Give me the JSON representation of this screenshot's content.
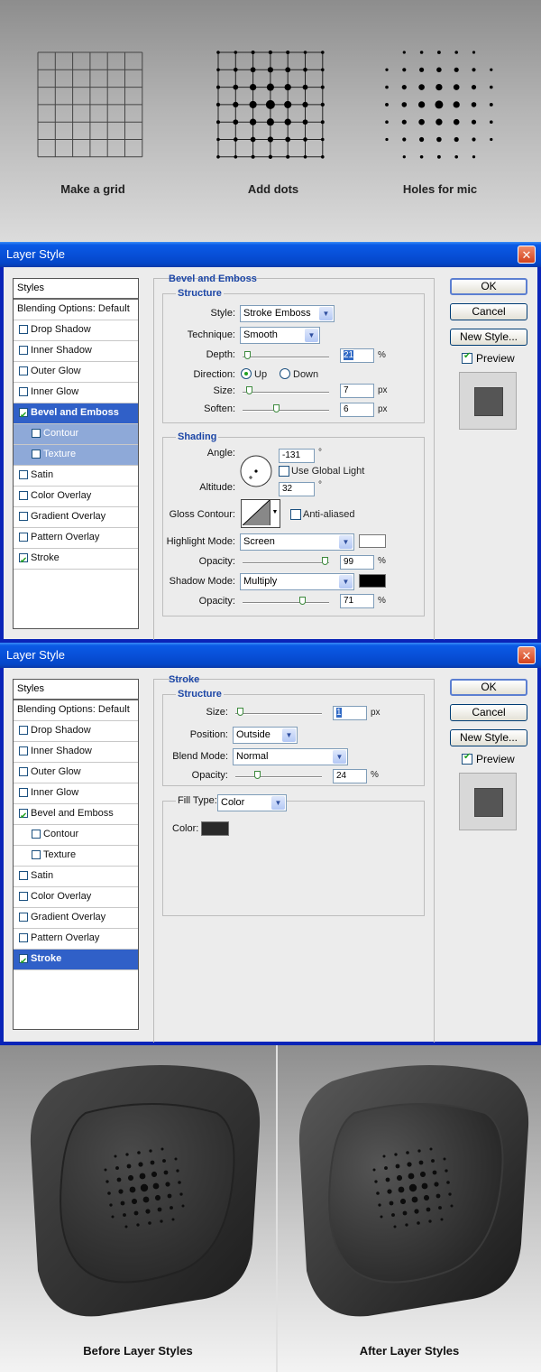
{
  "steps": {
    "captions": [
      "Make a grid",
      "Add dots",
      "Holes for mic"
    ],
    "icons": [
      "grid-icon",
      "grid-dots-icon",
      "mic-holes-icon"
    ]
  },
  "dialog1": {
    "title": "Layer Style",
    "close": "✕",
    "styles_header": "Styles",
    "blending": "Blending Options: Default",
    "items": [
      {
        "label": "Drop Shadow",
        "checked": false
      },
      {
        "label": "Inner Shadow",
        "checked": false
      },
      {
        "label": "Outer Glow",
        "checked": false
      },
      {
        "label": "Inner Glow",
        "checked": false
      },
      {
        "label": "Bevel and Emboss",
        "checked": true,
        "selected": true
      },
      {
        "label": "Contour",
        "checked": false
      },
      {
        "label": "Texture",
        "checked": false
      },
      {
        "label": "Satin",
        "checked": false
      },
      {
        "label": "Color Overlay",
        "checked": false
      },
      {
        "label": "Gradient Overlay",
        "checked": false
      },
      {
        "label": "Pattern Overlay",
        "checked": false
      },
      {
        "label": "Stroke",
        "checked": true
      }
    ],
    "section": "Bevel and Emboss",
    "structure": "Structure",
    "style_label": "Style:",
    "style_value": "Stroke Emboss",
    "technique_label": "Technique:",
    "technique_value": "Smooth",
    "depth_label": "Depth:",
    "depth_value": "21",
    "depth_unit": "%",
    "direction_label": "Direction:",
    "up": "Up",
    "down": "Down",
    "size_label": "Size:",
    "size_value": "7",
    "size_unit": "px",
    "soften_label": "Soften:",
    "soften_value": "6",
    "soften_unit": "px",
    "shading": "Shading",
    "angle_label": "Angle:",
    "angle_value": "-131",
    "degree": "°",
    "global_light": "Use Global Light",
    "altitude_label": "Altitude:",
    "altitude_value": "32",
    "gloss_label": "Gloss Contour:",
    "antialiased": "Anti-aliased",
    "highlight_label": "Highlight Mode:",
    "highlight_value": "Screen",
    "highlight_color": "#ffffff",
    "hl_opacity_label": "Opacity:",
    "hl_opacity_value": "99",
    "pct": "%",
    "shadow_label": "Shadow Mode:",
    "shadow_value": "Multiply",
    "shadow_color": "#000000",
    "sh_opacity_label": "Opacity:",
    "sh_opacity_value": "71",
    "depth_level": 0.02,
    "size_level": 0.05,
    "soften_level": 0.38,
    "hl_opacity_level": 0.99,
    "sh_opacity_level": 0.71,
    "ok": "OK",
    "cancel": "Cancel",
    "new_style": "New Style...",
    "preview": "Preview"
  },
  "dialog2": {
    "title": "Layer Style",
    "close": "✕",
    "styles_header": "Styles",
    "blending": "Blending Options: Default",
    "items": [
      {
        "label": "Drop Shadow",
        "checked": false
      },
      {
        "label": "Inner Shadow",
        "checked": false
      },
      {
        "label": "Outer Glow",
        "checked": false
      },
      {
        "label": "Inner Glow",
        "checked": false
      },
      {
        "label": "Bevel and Emboss",
        "checked": true
      },
      {
        "label": "Contour",
        "checked": false
      },
      {
        "label": "Texture",
        "checked": false
      },
      {
        "label": "Satin",
        "checked": false
      },
      {
        "label": "Color Overlay",
        "checked": false
      },
      {
        "label": "Gradient Overlay",
        "checked": false
      },
      {
        "label": "Pattern Overlay",
        "checked": false
      },
      {
        "label": "Stroke",
        "checked": true,
        "selected": true
      }
    ],
    "section": "Stroke",
    "structure": "Structure",
    "size_label": "Size:",
    "size_value": "1",
    "size_unit": "px",
    "position_label": "Position:",
    "position_value": "Outside",
    "blend_label": "Blend Mode:",
    "blend_value": "Normal",
    "opacity_label": "Opacity:",
    "opacity_value": "24",
    "pct": "%",
    "filltype_label": "Fill Type:",
    "filltype_value": "Color",
    "color_label": "Color:",
    "color": "#2a2a2a",
    "size_level": 0.02,
    "opacity_level": 0.24,
    "ok": "OK",
    "cancel": "Cancel",
    "new_style": "New Style...",
    "preview": "Preview"
  },
  "bottom": {
    "before": "Before Layer Styles",
    "after": "After Layer Styles"
  }
}
